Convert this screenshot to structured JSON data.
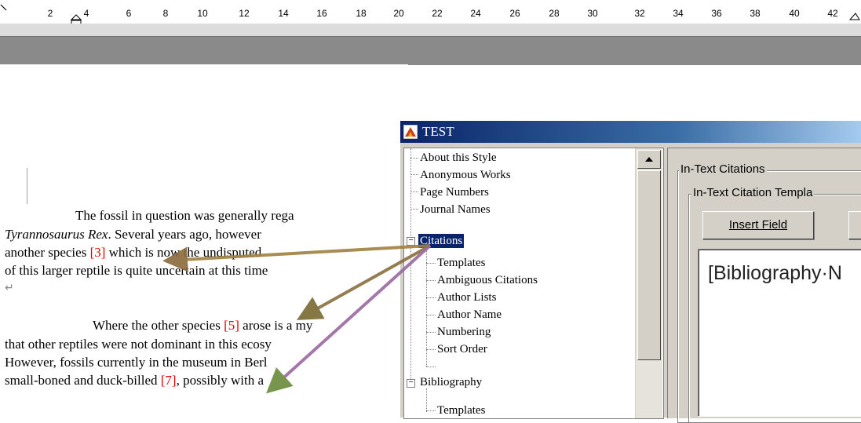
{
  "ruler": {
    "numbers": [
      "2",
      "4",
      "6",
      "8",
      "10",
      "12",
      "14",
      "16",
      "18",
      "20",
      "22",
      "24",
      "26",
      "28",
      "30",
      "32",
      "34",
      "36",
      "38",
      "40",
      "42"
    ]
  },
  "document": {
    "p1": {
      "line1": "The fossil in question was generally rega",
      "line2_italic": "Tyrannosaurus Rex",
      "line2_rest": ".  Several years ago, however",
      "line3_a": "another species ",
      "line3_cite": "[3]",
      "line3_b": " which is now the undisputed",
      "line4": "of this larger reptile is quite uncertain at this time",
      "return_mark": "↵"
    },
    "p2": {
      "line1_a": "Where the other species ",
      "line1_cite": "[5]",
      "line1_b": " arose is a my",
      "line2": "that other reptiles were not dominant in this ecosy",
      "line3": "However, fossils currently in the museum in Berl",
      "line4_a": "small-boned and duck-billed ",
      "line4_cite": "[7]",
      "line4_b": ", possibly with a"
    }
  },
  "dialog": {
    "title": "TEST",
    "tree": {
      "items": [
        {
          "label": "About this Style"
        },
        {
          "label": "Anonymous Works"
        },
        {
          "label": "Page Numbers"
        },
        {
          "label": "Journal Names"
        },
        {
          "label": "Citations"
        },
        {
          "label": "Templates"
        },
        {
          "label": "Ambiguous Citations"
        },
        {
          "label": "Author Lists"
        },
        {
          "label": "Author Name"
        },
        {
          "label": "Numbering"
        },
        {
          "label": "Sort Order"
        },
        {
          "label": "Bibliography"
        },
        {
          "label": "Templates"
        }
      ]
    },
    "right": {
      "group1_label": "In-Text Citations",
      "group2_label": "In-Text Citation Templa",
      "insert_field": "Insert Field",
      "template_text": "[Bibliography·N"
    }
  },
  "colors": {
    "citation_red": "#e00000",
    "titlebar_dark": "#0a246a",
    "selection": "#0a246a"
  }
}
